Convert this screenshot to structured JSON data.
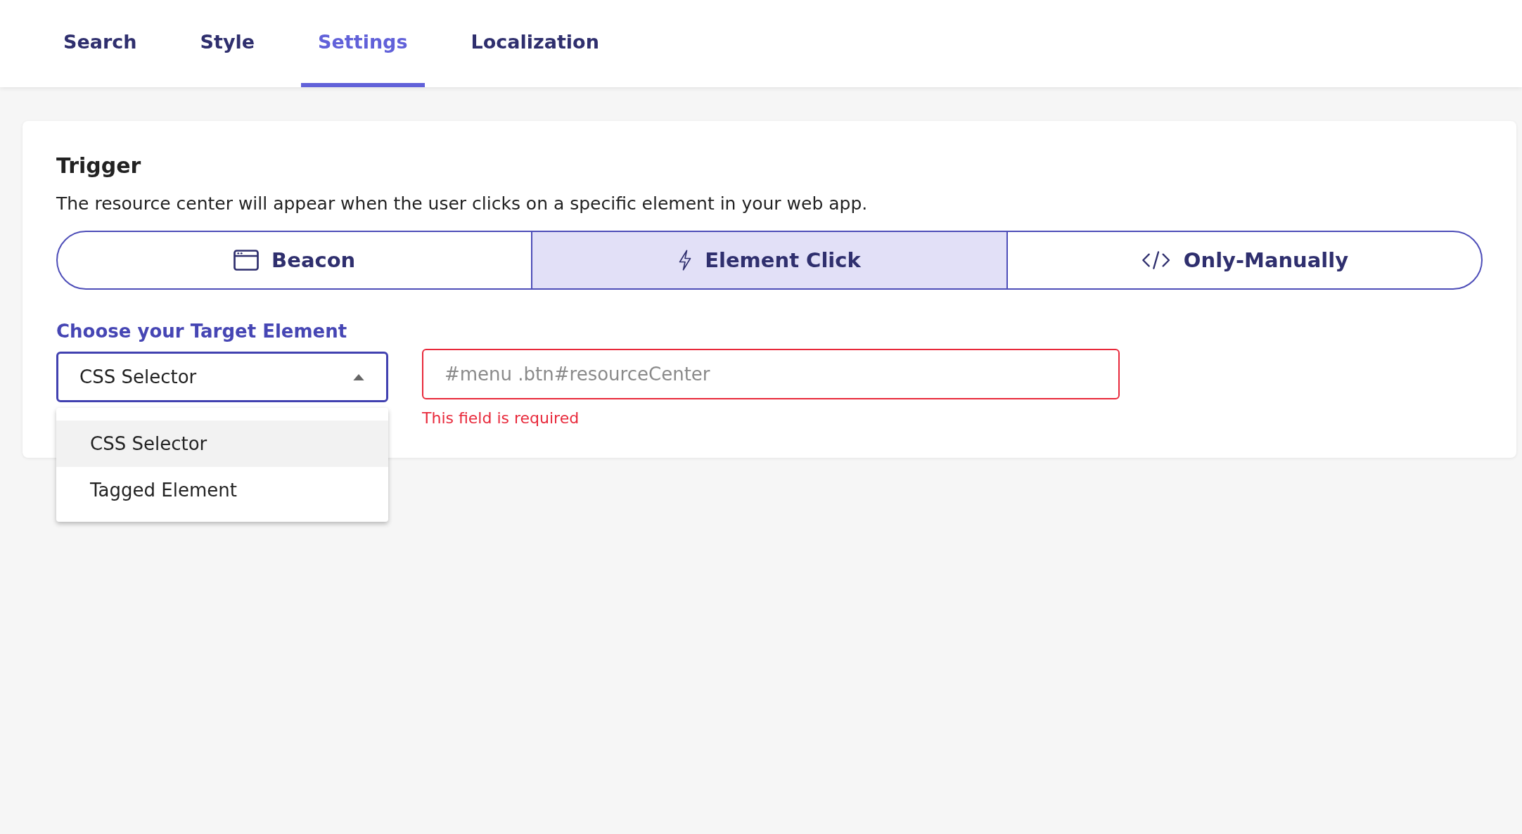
{
  "tabs": [
    {
      "label": "Search",
      "selected": false
    },
    {
      "label": "Style",
      "selected": false
    },
    {
      "label": "Settings",
      "selected": true
    },
    {
      "label": "Localization",
      "selected": false
    }
  ],
  "trigger": {
    "title": "Trigger",
    "description": "The resource center will appear when the user clicks on a specific element in your web app.",
    "options": [
      {
        "label": "Beacon",
        "kind": "beacon",
        "selected": false
      },
      {
        "label": "Element Click",
        "kind": "bolt",
        "selected": true
      },
      {
        "label": "Only-Manually",
        "kind": "code",
        "selected": false
      }
    ]
  },
  "target": {
    "label": "Choose your Target Element",
    "select_value": "CSS Selector",
    "expanded": true,
    "menu": [
      {
        "label": "CSS Selector",
        "selected": true
      },
      {
        "label": "Tagged Element",
        "selected": false
      }
    ],
    "selector_field": {
      "placeholder": "#menu .btn#resourceCenter",
      "error": "This field is required"
    }
  }
}
